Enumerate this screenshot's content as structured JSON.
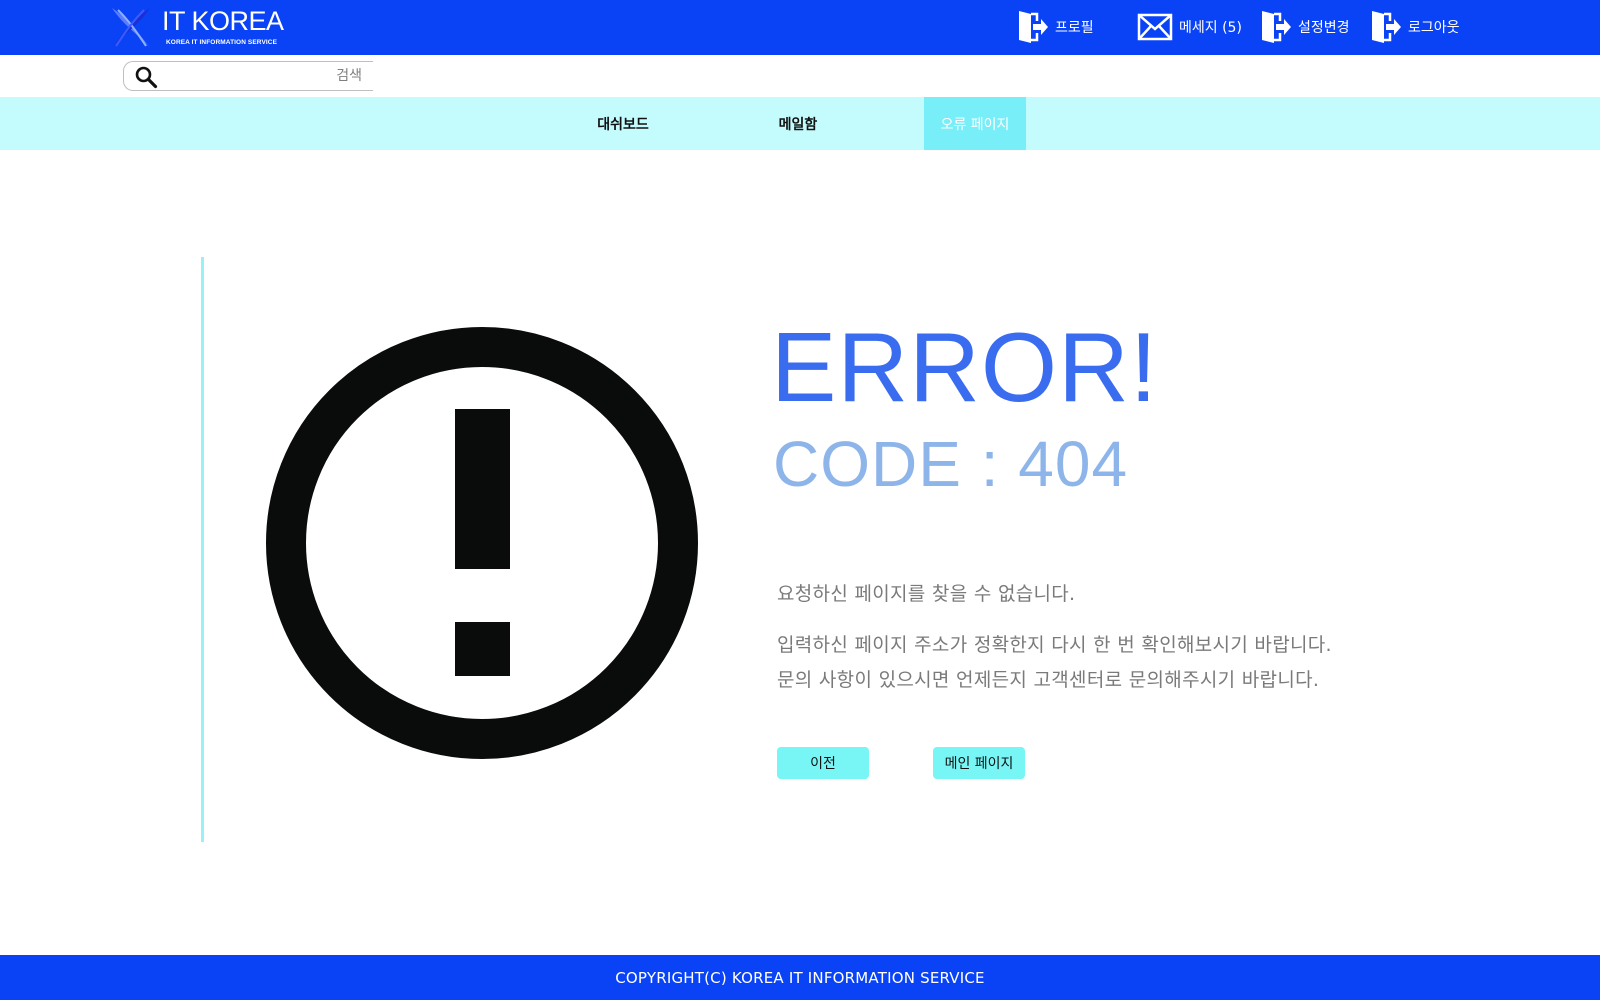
{
  "header": {
    "logo_title": "IT KOREA",
    "logo_subtitle": "KOREA IT INFORMATION SERVICE",
    "nav": [
      {
        "label": "프로필",
        "icon": "door-exit-icon"
      },
      {
        "label": "메세지 (5)",
        "icon": "envelope-icon"
      },
      {
        "label": "설정변경",
        "icon": "door-exit-icon"
      },
      {
        "label": "로그아웃",
        "icon": "door-exit-icon"
      }
    ]
  },
  "search": {
    "placeholder": "검색",
    "value": "",
    "icon": "search-icon"
  },
  "main_nav": {
    "tabs": [
      {
        "label": "대쉬보드",
        "active": false
      },
      {
        "label": "메일함",
        "active": false
      },
      {
        "label": "오류 페이지",
        "active": true
      }
    ]
  },
  "error": {
    "icon": "exclamation-circle-icon",
    "title": "ERROR!",
    "code": "CODE : 404",
    "messages": [
      "요청하신 페이지를 찾을 수 없습니다.",
      "입력하신 페이지 주소가 정확한지 다시 한 번 확인해보시기 바랍니다.",
      "문의 사항이 있으시면 언제든지 고객센터로 문의해주시기 바랍니다."
    ],
    "buttons": {
      "prev": "이전",
      "main": "메인 페이지"
    }
  },
  "footer": {
    "text": "COPYRIGHT(C) KOREA IT INFORMATION SERVICE"
  },
  "colors": {
    "brand_blue": "#0a43f5",
    "nav_bg": "#c4fcfd",
    "active_tab": "#78eef9",
    "button_bg": "#78f6f6",
    "error_title": "#3a6cf0",
    "error_code": "#8db5ea"
  }
}
